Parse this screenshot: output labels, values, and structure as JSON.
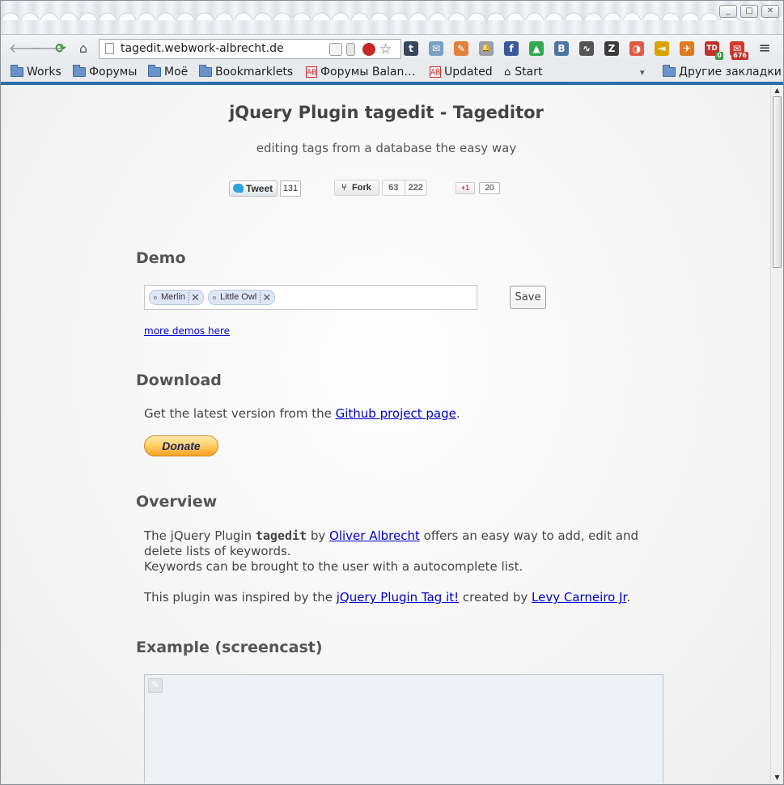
{
  "window": {
    "controls": {
      "minimize": "_",
      "maximize": "□",
      "close": "✕"
    }
  },
  "toolbar": {
    "url": "tagedit.webwork-albrecht.de",
    "extensions": [
      {
        "name": "tumblr-icon",
        "glyph": "t",
        "color": "#36465d"
      },
      {
        "name": "mail-icon",
        "glyph": "✉",
        "color": "#7aa0c4"
      },
      {
        "name": "pencil-icon",
        "glyph": "✎",
        "color": "#e2813b"
      },
      {
        "name": "bell-icon",
        "glyph": "🔔",
        "color": "#9aa0a6"
      },
      {
        "name": "facebook-icon",
        "glyph": "f",
        "color": "#3b5998"
      },
      {
        "name": "google-drive-icon",
        "glyph": "▲",
        "color": "#34a853"
      },
      {
        "name": "vk-icon",
        "glyph": "B",
        "color": "#4c75a3"
      },
      {
        "name": "chart-icon",
        "glyph": "∿",
        "color": "#555555"
      },
      {
        "name": "z-icon",
        "glyph": "Z",
        "color": "#3c3c3c"
      },
      {
        "name": "pocket-icon",
        "glyph": "◑",
        "color": "#e05a47"
      },
      {
        "name": "phone-icon",
        "glyph": "⇥",
        "color": "#d9a300"
      },
      {
        "name": "bird-icon",
        "glyph": "✈",
        "color": "#e07a1f"
      },
      {
        "name": "td-icon",
        "glyph": "TD",
        "color": "#c0332b",
        "badge": "0",
        "badge_color": "#3c9a3c"
      },
      {
        "name": "gmail-icon",
        "glyph": "✉",
        "color": "#d23a2e",
        "badge": "676",
        "badge_color": "#c0332b"
      }
    ]
  },
  "bookmarks": [
    {
      "label": "Works",
      "kind": "folder"
    },
    {
      "label": "Форумы",
      "kind": "folder"
    },
    {
      "label": "Моё",
      "kind": "folder"
    },
    {
      "label": "Bookmarklets",
      "kind": "folder"
    },
    {
      "label": "Форумы Balan…",
      "kind": "page"
    },
    {
      "label": "Updated",
      "kind": "page"
    },
    {
      "label": "Start",
      "kind": "home"
    }
  ],
  "bookmarks_other": "Другие закладки",
  "bookmarks_overflow": "▾",
  "page": {
    "title": "jQuery Plugin tagedit - Tageditor",
    "subtitle": "editing tags from a database the easy way",
    "social": {
      "tweet_label": "Tweet",
      "tweet_count": "131",
      "fork_label": "Fork",
      "fork_stars": "63",
      "fork_count": "222",
      "gplus_label": "+1",
      "gplus_count": "20"
    },
    "demo": {
      "heading": "Demo",
      "tags": [
        "Merlin",
        "Little Owl"
      ],
      "save_label": "Save",
      "more_link": "more demos here"
    },
    "download": {
      "heading": "Download",
      "text_before": "Get the latest version from the ",
      "link": "Github project page",
      "text_after": ".",
      "donate_label": "Donate"
    },
    "overview": {
      "heading": "Overview",
      "p1_a": "The jQuery Plugin ",
      "p1_bold": "tagedit",
      "p1_b": " by ",
      "p1_link": "Oliver Albrecht",
      "p1_c": " offers an easy way to add, edit and",
      "p1_line2": "delete lists of keywords.",
      "p1_line3": "Keywords can be brought to the user with a autocomplete list.",
      "p2_a": "This plugin was inspired by the ",
      "p2_link1": "jQuery Plugin Tag it!",
      "p2_b": " created by ",
      "p2_link2": "Levy Carneiro Jr",
      "p2_c": "."
    },
    "example": {
      "heading": "Example (screencast)"
    }
  },
  "scrollbar": {
    "up": "▲",
    "down": "▼"
  }
}
